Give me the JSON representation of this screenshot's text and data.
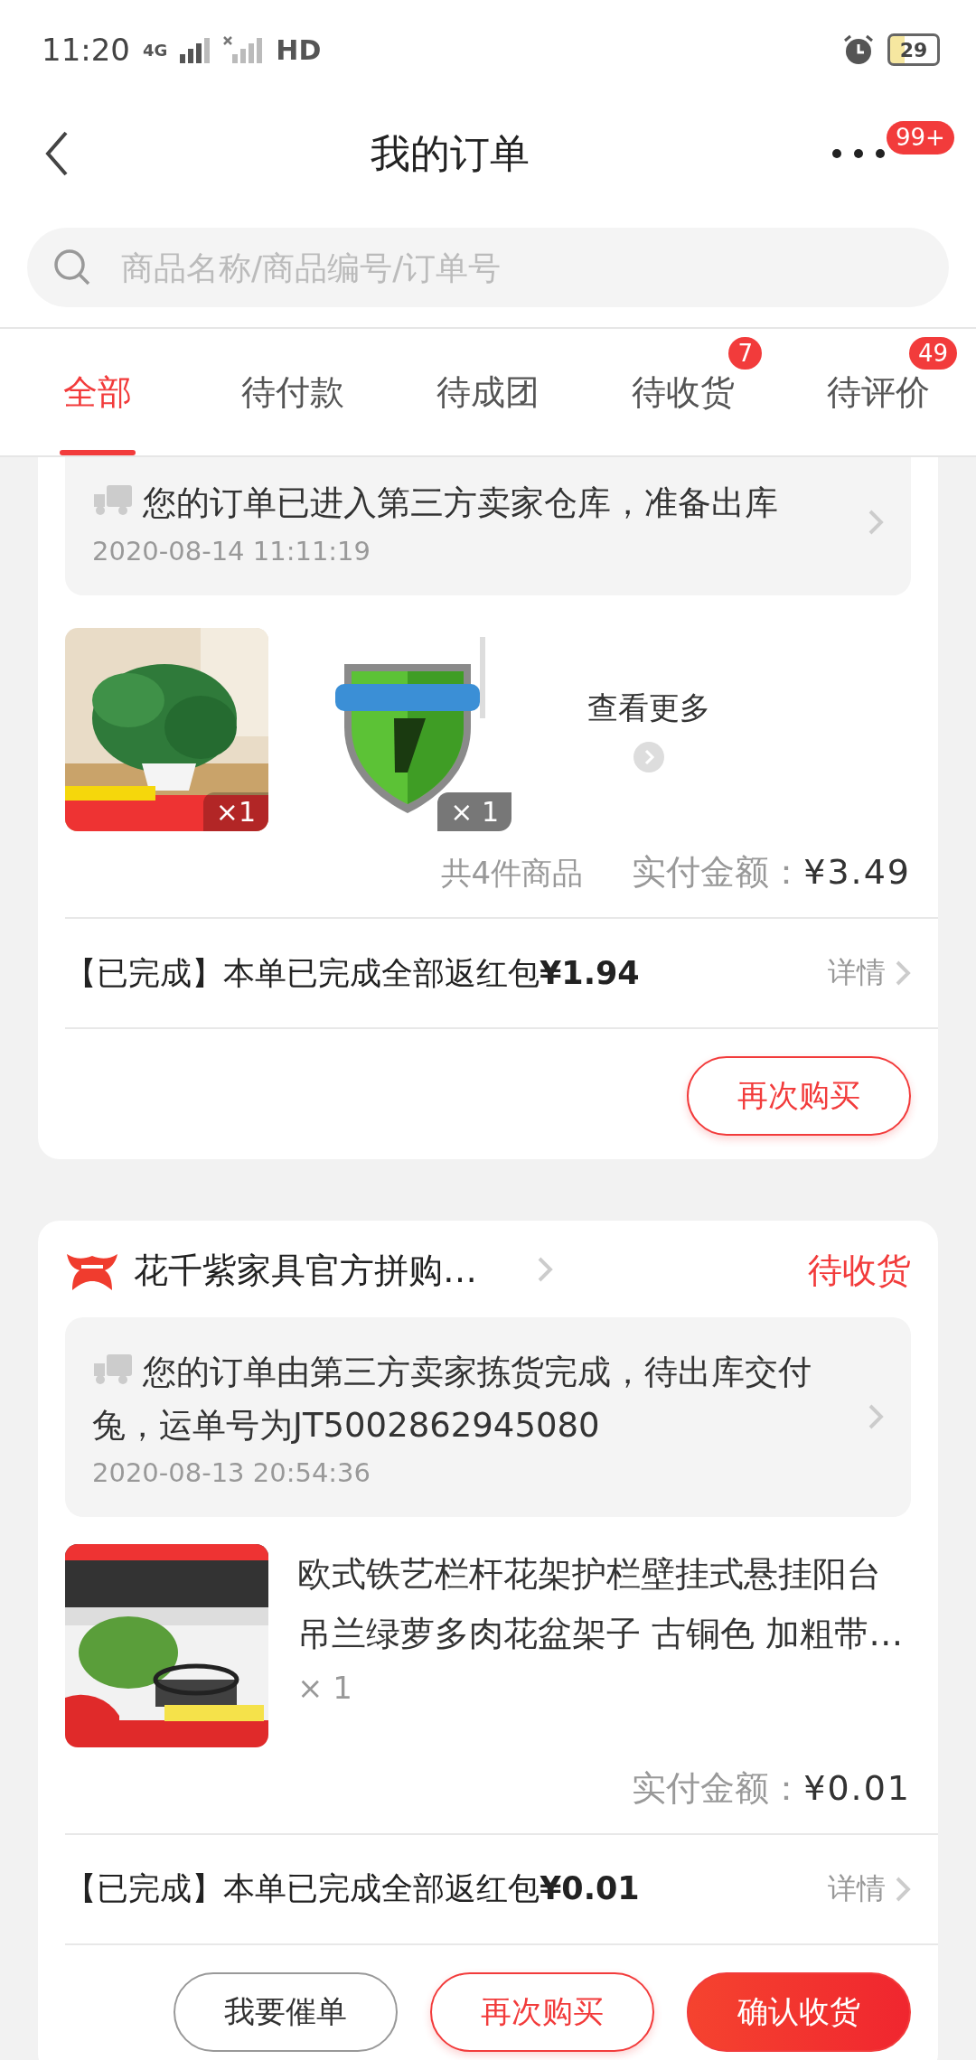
{
  "status_bar": {
    "time": "11:20",
    "network": "4G",
    "hd": "HD",
    "battery": "29"
  },
  "header": {
    "title": "我的订单",
    "badge": "99+"
  },
  "search": {
    "placeholder": "商品名称/商品编号/订单号"
  },
  "tabs": [
    {
      "label": "全部",
      "selected": true
    },
    {
      "label": "待付款",
      "selected": false
    },
    {
      "label": "待成团",
      "selected": false
    },
    {
      "label": "待收货",
      "selected": false,
      "badge": "7"
    },
    {
      "label": "待评价",
      "selected": false,
      "badge": "49"
    }
  ],
  "orders": [
    {
      "tracking": {
        "message": "您的订单已进入第三方卖家仓库，准备出库",
        "time": "2020-08-14 11:11:19"
      },
      "kind": "thumbs",
      "thumbs": [
        {
          "count": "×1"
        },
        {
          "count": "× 1"
        }
      ],
      "more_label": "查看更多",
      "item_count": "共4件商品",
      "paid_label": "实付金额：",
      "paid": "¥3.49",
      "rebate": "【已完成】本单已完成全部返红包**¥1.94**",
      "detail": "详情",
      "buttons": [
        {
          "label": "再次购买",
          "kind": "outline-red"
        }
      ]
    },
    {
      "shop": "花千紫家具官方拼购…",
      "status": "待收货",
      "tracking": {
        "message": "您的订单由第三方卖家拣货完成，待出库交付兔，运单号为JT5002862945080",
        "time": "2020-08-13 20:54:36"
      },
      "kind": "single",
      "product": {
        "title": "欧式铁艺栏杆花架护栏壁挂式悬挂阳台吊兰绿萝多肉花盆架子 古铜色 加粗带…",
        "count": "× 1"
      },
      "paid_label": "实付金额：",
      "paid": "¥0.01",
      "rebate": "【已完成】本单已完成全部返红包**¥0.01**",
      "detail": "详情",
      "buttons": [
        {
          "label": "我要催单",
          "kind": "outline-grey"
        },
        {
          "label": "再次购买",
          "kind": "outline-red"
        },
        {
          "label": "确认收货",
          "kind": "filled-red"
        }
      ]
    }
  ]
}
